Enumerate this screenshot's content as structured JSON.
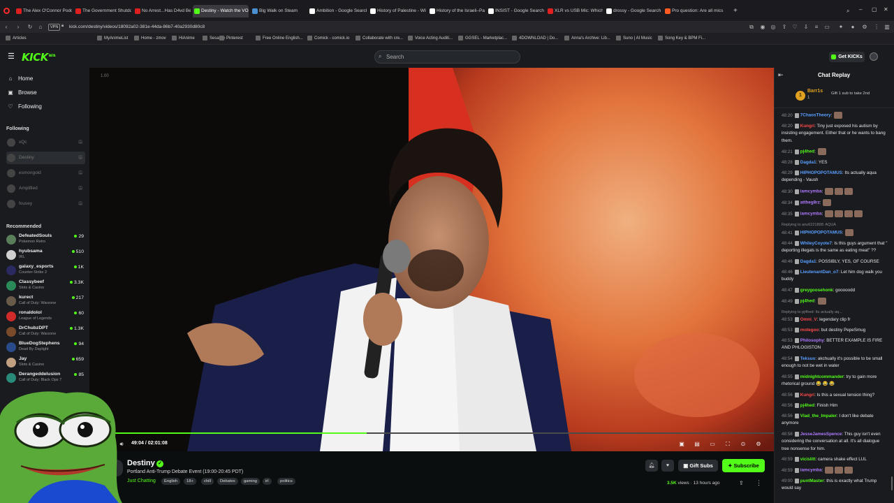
{
  "browser": {
    "tabs": [
      {
        "title": "The Alex O'Connor Podca",
        "color": "#e02020",
        "active": false
      },
      {
        "title": "The Government Shutdow",
        "color": "#e02020",
        "active": false
      },
      {
        "title": "No Arrest...Has D4vd Bee",
        "color": "#e02020",
        "active": false
      },
      {
        "title": "Destiny - Watch the VOD",
        "color": "#53fc18",
        "active": true
      },
      {
        "title": "Big Walk on Steam",
        "color": "#4a8fd0",
        "active": false
      },
      {
        "title": "Ambition - Google Search",
        "color": "#ffffff",
        "active": false
      },
      {
        "title": "History of Palestine - Wiki",
        "color": "#ffffff",
        "active": false
      },
      {
        "title": "History of the Israeli–Pale",
        "color": "#ffffff",
        "active": false
      },
      {
        "title": "INSIST - Google Search",
        "color": "#ffffff",
        "active": false
      },
      {
        "title": "XLR vs USB Mic: Which Sh",
        "color": "#e02020",
        "active": false
      },
      {
        "title": "drossy - Google Search",
        "color": "#ffffff",
        "active": false
      },
      {
        "title": "Pro question: Are all mics",
        "color": "#ff5a1f",
        "active": false
      }
    ],
    "url": "kick.com/destiny/videos/18092a02-381e-44da-86b7-40a2930d80c8",
    "vpn_badge": "VPN",
    "bookmarks": [
      "Articles",
      "MyAnimeList",
      "Home - zmov",
      "HiAnime",
      "Sesame",
      "Pinterest",
      "Free Online English...",
      "Comick - comick.io",
      "Collaborate with cre...",
      "Voice Acting Auditi...",
      "GGSEL - Marketplac...",
      "4DOWNLOAD | Do...",
      "Anna's Archive: Lib...",
      "Suno | AI Music",
      "Song Key & BPM Fi..."
    ]
  },
  "header": {
    "logo": "KICK",
    "logo_badge": "BETA",
    "search_placeholder": "Search",
    "get_kicks": "Get KICKs"
  },
  "sidebar": {
    "nav": [
      {
        "label": "Home",
        "icon": "home-icon",
        "glyph": "⌂"
      },
      {
        "label": "Browse",
        "icon": "browse-icon",
        "glyph": "▣"
      },
      {
        "label": "Following",
        "icon": "heart-icon",
        "glyph": "♡"
      }
    ],
    "following_title": "Following",
    "following": [
      "xQc",
      "Destiny",
      "esmongold",
      "Amplified",
      "fousey"
    ],
    "recommended_title": "Recommended",
    "recommended": [
      {
        "name": "DefeatedSouls",
        "category": "Pokemon Retro",
        "viewers": "29",
        "color": "#5a7d5a"
      },
      {
        "name": "hyubsama",
        "category": "IRL",
        "viewers": "510",
        "color": "#d0d0d0"
      },
      {
        "name": "galaxy_esports",
        "category": "Counter-Strike 2",
        "viewers": "1K",
        "color": "#2a2a60"
      },
      {
        "name": "Classybeef",
        "category": "Slots & Casino",
        "viewers": "3.3K",
        "color": "#2a8a5a"
      },
      {
        "name": "kurect",
        "category": "Call of Duty: Warzone",
        "viewers": "217",
        "color": "#6a5a4a"
      },
      {
        "name": "ronaldolol",
        "category": "League of Legends",
        "viewers": "60",
        "color": "#d02a2a"
      },
      {
        "name": "DrChubzDPT",
        "category": "Call of Duty: Warzone",
        "viewers": "1.3K",
        "color": "#7a4a2a"
      },
      {
        "name": "BlueDogStephens",
        "category": "Dead By Daylight",
        "viewers": "94",
        "color": "#2a4a8a"
      },
      {
        "name": "Jay",
        "category": "Slots & Casino",
        "viewers": "659",
        "color": "#c0a080"
      },
      {
        "name": "Derangeddelusion",
        "category": "Call of Duty: Black Ops 7",
        "viewers": "85",
        "color": "#2a8a7a"
      }
    ]
  },
  "player": {
    "overlay_speed": "1.00",
    "time": "49:04 / 02:01:08",
    "progress_fraction": 0.405
  },
  "info": {
    "streamer": "Destiny",
    "title": "Portland Anti-Trump Debate Event (19:00-20:45 PDT)",
    "category": "Just Chatting",
    "tags": [
      "English",
      "18+",
      "chill",
      "Debates",
      "gaming",
      "irl",
      "politics"
    ],
    "gift_subs": "Gift Subs",
    "subscribe": "Subscribe",
    "views": "3.5K",
    "views_suffix": " views",
    "age": "13 hours ago"
  },
  "chat": {
    "title": "Chat Replay",
    "gifter_name": "Barr1s",
    "gifter_count": "1",
    "gifter_prompt": "Gift 1 sub to take 2nd",
    "messages": [
      {
        "ts": "48:20",
        "user": "7ChaosTheory",
        "color": "#5aa0ff",
        "text": ""
      },
      {
        "ts": "48:20",
        "user": "Kungri",
        "color": "#ff4a4a",
        "text": "Tiny just exposed his autism by insisting engagement. Either that or he wants to bang them."
      },
      {
        "ts": "48:21",
        "user": "pj4hed",
        "color": "#53fc18",
        "text": ""
      },
      {
        "ts": "48:28",
        "user": "Dagda1",
        "color": "#5aa0ff",
        "text": "YES"
      },
      {
        "ts": "48:29",
        "user": "HIPHOPOPOTAMUS",
        "color": "#5aa0ff",
        "text": "Its actually aqua depending - Vaush"
      },
      {
        "ts": "48:30",
        "user": "iamcymba",
        "color": "#b07aff",
        "text": ""
      },
      {
        "ts": "48:34",
        "user": "attheg8rz",
        "color": "#b07aff",
        "text": ""
      },
      {
        "ts": "48:35",
        "user": "iamcymba",
        "color": "#b07aff",
        "text": ""
      },
      {
        "ts": "",
        "user": "",
        "color": "#888",
        "text": "Replying to anu6221898: AQUA"
      },
      {
        "ts": "48:41",
        "user": "HIPHOPOPOTAMUS",
        "color": "#5aa0ff",
        "text": ""
      },
      {
        "ts": "48:44",
        "user": "WhileyCoyote7",
        "color": "#5aa0ff",
        "text": "Is this guys argument that \" deporting illegals is the same as eating meat\" ??"
      },
      {
        "ts": "48:46",
        "user": "Dagda1",
        "color": "#5aa0ff",
        "text": "POSSIBLY, YES, OF COURSE"
      },
      {
        "ts": "48:46",
        "user": "LieutenantDan_o7",
        "color": "#5aa0ff",
        "text": "Let him dog walk you buddy"
      },
      {
        "ts": "48:47",
        "user": "greygoosehonk",
        "color": "#53fc18",
        "text": "gooooodd"
      },
      {
        "ts": "48:49",
        "user": "pj4hed",
        "color": "#53fc18",
        "text": ""
      },
      {
        "ts": "",
        "user": "",
        "color": "#888",
        "text": "Replying to pj4hed: Its actually aq..."
      },
      {
        "ts": "48:53",
        "user": "Omni_V",
        "color": "#ff4a4a",
        "text": "legendary clip fr"
      },
      {
        "ts": "48:53",
        "user": "motegoo",
        "color": "#ff4a4a",
        "text": "but destiny PepeSmug"
      },
      {
        "ts": "48:53",
        "user": "Philosophy",
        "color": "#b07aff",
        "text": "BETTER EXAMPLE IS FIRE AND PHLOGISTON"
      },
      {
        "ts": "48:54",
        "user": "Teksuo",
        "color": "#5aa0ff",
        "text": "akchually it's possible to be small enough to not be wet in water"
      },
      {
        "ts": "48:55",
        "user": "midnightcommander",
        "color": "#53fc18",
        "text": "try to gain more rhetorical ground 😂 😂 😂"
      },
      {
        "ts": "48:56",
        "user": "Kungri",
        "color": "#ff4a4a",
        "text": "Is this a sexual tension thing?"
      },
      {
        "ts": "48:56",
        "user": "pj4hed",
        "color": "#53fc18",
        "text": "Finish Him"
      },
      {
        "ts": "48:56",
        "user": "Vlad_the_Impaler",
        "color": "#53fc18",
        "text": "I don't like debate anymore"
      },
      {
        "ts": "48:58",
        "user": "JesseJamesSpence",
        "color": "#b07aff",
        "text": "This guy isn't even considering the conversation at all. It's all dialogue tree nonsense for him."
      },
      {
        "ts": "48:59",
        "user": "vicislitt",
        "color": "#53fc18",
        "text": "camera shake effect LUL"
      },
      {
        "ts": "48:59",
        "user": "iamcymba",
        "color": "#b07aff",
        "text": ""
      },
      {
        "ts": "49:00",
        "user": "puntMaster",
        "color": "#53fc18",
        "text": "this is exactly what Trump would say"
      }
    ]
  }
}
